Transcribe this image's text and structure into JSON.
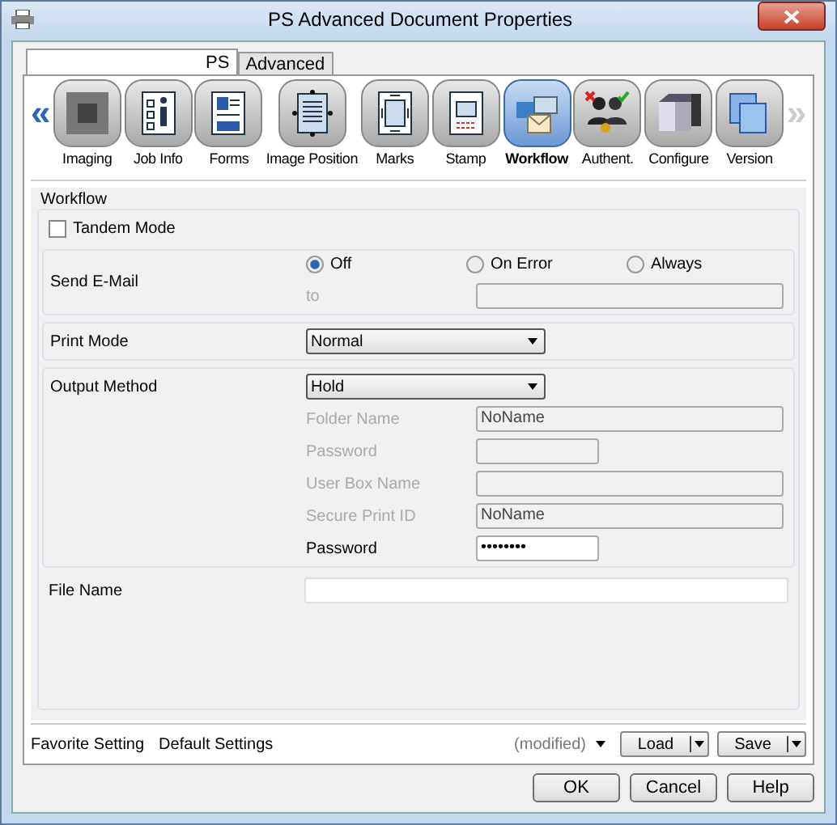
{
  "window": {
    "title": "PS Advanced Document Properties"
  },
  "tabs": [
    {
      "label": "PS",
      "selected": true
    },
    {
      "label": "Advanced",
      "selected": false
    }
  ],
  "categories": [
    {
      "label": "Imaging",
      "selected": false
    },
    {
      "label": "Job Info",
      "selected": false
    },
    {
      "label": "Forms",
      "selected": false
    },
    {
      "label": "Image Position",
      "selected": false
    },
    {
      "label": "Marks",
      "selected": false
    },
    {
      "label": "Stamp",
      "selected": false
    },
    {
      "label": "Workflow",
      "selected": true
    },
    {
      "label": "Authent.",
      "selected": false
    },
    {
      "label": "Configure",
      "selected": false
    },
    {
      "label": "Version",
      "selected": false
    }
  ],
  "scroll_left": {
    "label": "«",
    "disabled": false
  },
  "scroll_right": {
    "label": "»",
    "disabled": true
  },
  "panel": {
    "title": "Workflow",
    "tandem_mode": {
      "label": "Tandem Mode",
      "checked": false
    },
    "send_email": {
      "label": "Send E-Mail",
      "options": [
        {
          "label": "Off",
          "selected": true
        },
        {
          "label": "On Error",
          "selected": false
        },
        {
          "label": "Always",
          "selected": false
        }
      ],
      "to": {
        "label": "to",
        "disabled": true
      }
    },
    "print_mode": {
      "label": "Print Mode",
      "value": "Normal"
    },
    "output_method": {
      "label": "Output Method",
      "value": "Hold",
      "fields": [
        {
          "label": "Folder Name",
          "value": "NoName",
          "wide": true,
          "disabled": true
        },
        {
          "label": "Password",
          "wide": false,
          "disabled": true
        },
        {
          "label": "User Box Name",
          "wide": true,
          "disabled": true
        },
        {
          "label": "Secure Print ID",
          "value": "NoName",
          "wide": true,
          "disabled": true
        },
        {
          "label": "Password",
          "value": "••••••••",
          "wide": false,
          "disabled": false
        }
      ]
    },
    "file_name": {
      "label": "File Name"
    }
  },
  "favorite": {
    "label": "Favorite Setting",
    "value": "Default Settings",
    "note": "(modified)",
    "buttons": [
      "Load",
      "Save"
    ]
  },
  "buttons": [
    "OK",
    "Cancel",
    "Help"
  ]
}
